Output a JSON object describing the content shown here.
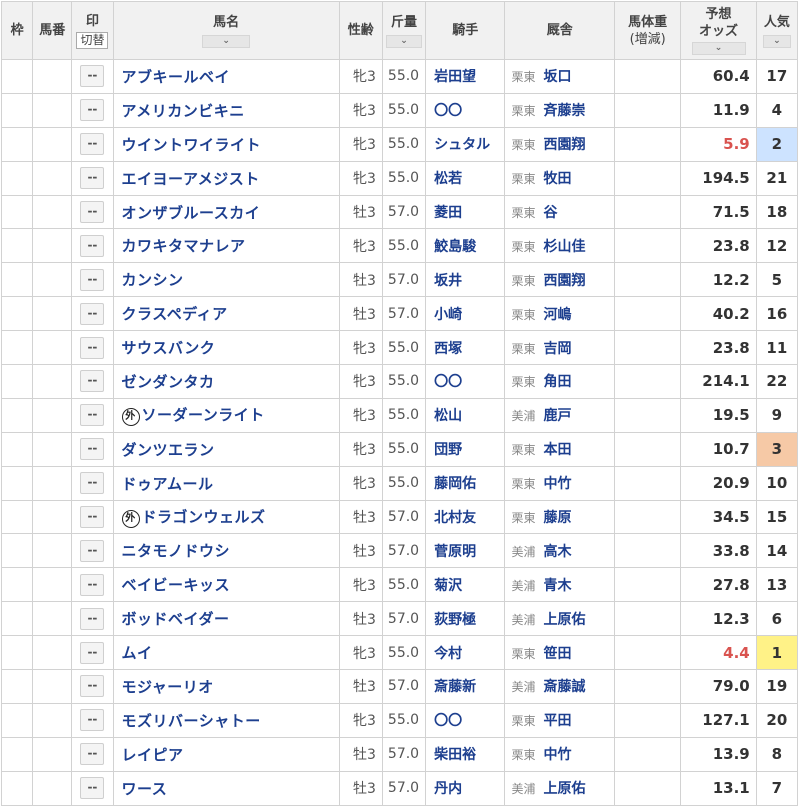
{
  "headers": {
    "waku": "枠",
    "umaban": "馬番",
    "mark": "印",
    "mark_toggle": "切替",
    "name": "馬名",
    "sort_icon": "chevron-down",
    "sexage": "性齢",
    "kinryo": "斤量",
    "jockey": "騎手",
    "stable": "厩舎",
    "weight_line1": "馬体重",
    "weight_line2": "(増減)",
    "odds_line1": "予想",
    "odds_line2": "オッズ",
    "popularity": "人気"
  },
  "mark_label": "--",
  "gai_label": "外",
  "colors": {
    "link": "#1d3f8f",
    "hot_odds": "#d9534f",
    "pop1": "#fff287",
    "pop2": "#cde3ff",
    "pop3": "#f6c9a6"
  },
  "horses": [
    {
      "name": "アブキールベイ",
      "gai": false,
      "sex": "牝3",
      "kinryo": "55.0",
      "jockey": "岩田望",
      "region": "栗東",
      "trainer": "坂口",
      "odds": "60.4",
      "pop": "17"
    },
    {
      "name": "アメリカンビキニ",
      "gai": false,
      "sex": "牝3",
      "kinryo": "55.0",
      "jockey": "〇〇",
      "region": "栗東",
      "trainer": "斉藤崇",
      "odds": "11.9",
      "pop": "4"
    },
    {
      "name": "ウイントワイライト",
      "gai": false,
      "sex": "牝3",
      "kinryo": "55.0",
      "jockey": "シュタル",
      "region": "栗東",
      "trainer": "西園翔",
      "odds": "5.9",
      "pop": "2"
    },
    {
      "name": "エイヨーアメジスト",
      "gai": false,
      "sex": "牝3",
      "kinryo": "55.0",
      "jockey": "松若",
      "region": "栗東",
      "trainer": "牧田",
      "odds": "194.5",
      "pop": "21"
    },
    {
      "name": "オンザブルースカイ",
      "gai": false,
      "sex": "牡3",
      "kinryo": "57.0",
      "jockey": "菱田",
      "region": "栗東",
      "trainer": "谷",
      "odds": "71.5",
      "pop": "18"
    },
    {
      "name": "カワキタマナレア",
      "gai": false,
      "sex": "牝3",
      "kinryo": "55.0",
      "jockey": "鮫島駿",
      "region": "栗東",
      "trainer": "杉山佳",
      "odds": "23.8",
      "pop": "12"
    },
    {
      "name": "カンシン",
      "gai": false,
      "sex": "牡3",
      "kinryo": "57.0",
      "jockey": "坂井",
      "region": "栗東",
      "trainer": "西園翔",
      "odds": "12.2",
      "pop": "5"
    },
    {
      "name": "クラスペディア",
      "gai": false,
      "sex": "牡3",
      "kinryo": "57.0",
      "jockey": "小崎",
      "region": "栗東",
      "trainer": "河嶋",
      "odds": "40.2",
      "pop": "16"
    },
    {
      "name": "サウスバンク",
      "gai": false,
      "sex": "牝3",
      "kinryo": "55.0",
      "jockey": "西塚",
      "region": "栗東",
      "trainer": "吉岡",
      "odds": "23.8",
      "pop": "11"
    },
    {
      "name": "ゼンダンタカ",
      "gai": false,
      "sex": "牝3",
      "kinryo": "55.0",
      "jockey": "〇〇",
      "region": "栗東",
      "trainer": "角田",
      "odds": "214.1",
      "pop": "22"
    },
    {
      "name": "ソーダーンライト",
      "gai": true,
      "sex": "牝3",
      "kinryo": "55.0",
      "jockey": "松山",
      "region": "美浦",
      "trainer": "鹿戸",
      "odds": "19.5",
      "pop": "9"
    },
    {
      "name": "ダンツエラン",
      "gai": false,
      "sex": "牝3",
      "kinryo": "55.0",
      "jockey": "団野",
      "region": "栗東",
      "trainer": "本田",
      "odds": "10.7",
      "pop": "3"
    },
    {
      "name": "ドゥアムール",
      "gai": false,
      "sex": "牝3",
      "kinryo": "55.0",
      "jockey": "藤岡佑",
      "region": "栗東",
      "trainer": "中竹",
      "odds": "20.9",
      "pop": "10"
    },
    {
      "name": "ドラゴンウェルズ",
      "gai": true,
      "sex": "牡3",
      "kinryo": "57.0",
      "jockey": "北村友",
      "region": "栗東",
      "trainer": "藤原",
      "odds": "34.5",
      "pop": "15"
    },
    {
      "name": "ニタモノドウシ",
      "gai": false,
      "sex": "牡3",
      "kinryo": "57.0",
      "jockey": "菅原明",
      "region": "美浦",
      "trainer": "高木",
      "odds": "33.8",
      "pop": "14"
    },
    {
      "name": "ベイビーキッス",
      "gai": false,
      "sex": "牝3",
      "kinryo": "55.0",
      "jockey": "菊沢",
      "region": "美浦",
      "trainer": "青木",
      "odds": "27.8",
      "pop": "13"
    },
    {
      "name": "ボッドベイダー",
      "gai": false,
      "sex": "牡3",
      "kinryo": "57.0",
      "jockey": "荻野極",
      "region": "美浦",
      "trainer": "上原佑",
      "odds": "12.3",
      "pop": "6"
    },
    {
      "name": "ムイ",
      "gai": false,
      "sex": "牝3",
      "kinryo": "55.0",
      "jockey": "今村",
      "region": "栗東",
      "trainer": "笹田",
      "odds": "4.4",
      "pop": "1"
    },
    {
      "name": "モジャーリオ",
      "gai": false,
      "sex": "牡3",
      "kinryo": "57.0",
      "jockey": "斎藤新",
      "region": "美浦",
      "trainer": "斎藤誠",
      "odds": "79.0",
      "pop": "19"
    },
    {
      "name": "モズリバーシャトー",
      "gai": false,
      "sex": "牝3",
      "kinryo": "55.0",
      "jockey": "〇〇",
      "region": "栗東",
      "trainer": "平田",
      "odds": "127.1",
      "pop": "20"
    },
    {
      "name": "レイピア",
      "gai": false,
      "sex": "牡3",
      "kinryo": "57.0",
      "jockey": "柴田裕",
      "region": "栗東",
      "trainer": "中竹",
      "odds": "13.9",
      "pop": "8"
    },
    {
      "name": "ワース",
      "gai": false,
      "sex": "牡3",
      "kinryo": "57.0",
      "jockey": "丹内",
      "region": "美浦",
      "trainer": "上原佑",
      "odds": "13.1",
      "pop": "7"
    }
  ]
}
